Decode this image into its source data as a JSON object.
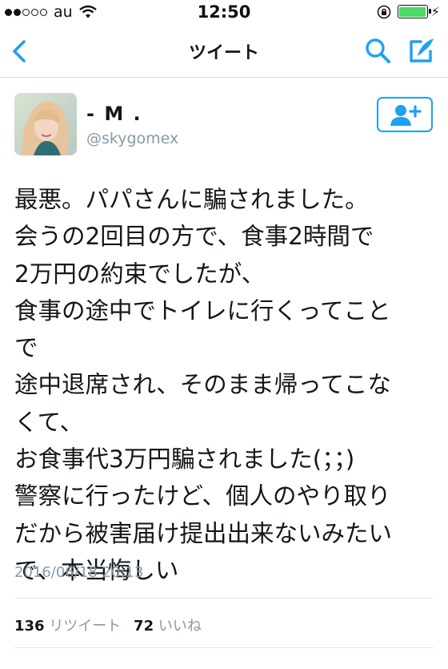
{
  "status_bar": {
    "carrier": "au",
    "time": "12:50"
  },
  "nav": {
    "title": "ツイート"
  },
  "user": {
    "display_name": "- M .",
    "handle": "@skygomex"
  },
  "tweet": {
    "lines": [
      "最悪。パパさんに騙されました。",
      "会うの2回目の方で、食事2時間で",
      "2万円の約束でしたが、",
      "食事の途中でトイレに行くってこと",
      "で",
      "途中退席され、そのまま帰ってこな",
      "くて、",
      "お食事代3万円騙されました(；；)",
      "警察に行ったけど、個人のやり取り",
      "だから被害届け提出出来ないみたい",
      "で、本当悔しい"
    ],
    "timestamp": "2016/06/18 20:13"
  },
  "stats": {
    "retweets_count": "136",
    "retweets_label": "リツイート",
    "likes_count": "72",
    "likes_label": "いいね"
  },
  "colors": {
    "accent": "#1da1f2",
    "muted": "#8899a6",
    "text": "#14171a"
  }
}
